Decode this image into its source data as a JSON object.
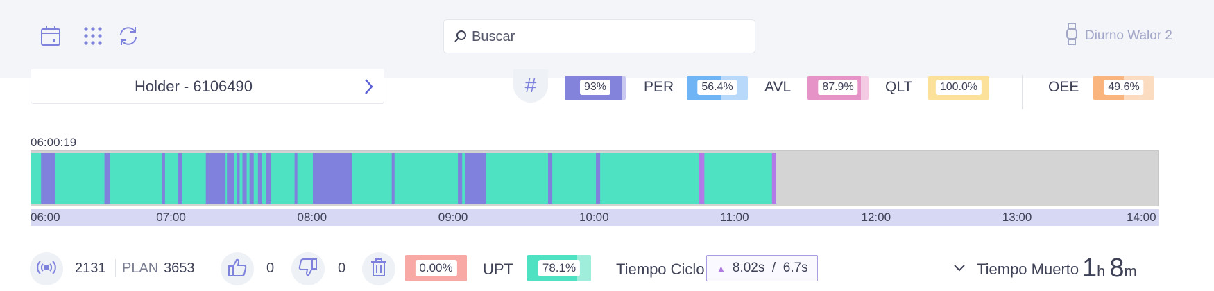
{
  "header": {
    "search_placeholder": "Buscar",
    "user_name": "Diurno Walor 2",
    "icons": [
      "calendar-icon",
      "apps-grid-icon",
      "refresh-icon",
      "watch-icon",
      "search-icon"
    ]
  },
  "holder": {
    "label": "Holder - 6106490"
  },
  "kpis": [
    {
      "name": "#",
      "label": "",
      "value": "93%",
      "fraction": 0.93,
      "color": "#8383dc",
      "light": "#c8c8f0"
    },
    {
      "name": "PER",
      "label": "PER",
      "value": "56.4%",
      "fraction": 0.564,
      "color": "#6fb4f5",
      "light": "#b8d9fa"
    },
    {
      "name": "AVL",
      "label": "AVL",
      "value": "87.9%",
      "fraction": 0.879,
      "color": "#e693c8",
      "light": "#f4cbe3"
    },
    {
      "name": "QLT",
      "label": "QLT",
      "value": "100.0%",
      "fraction": 1.0,
      "color": "#fbe19a",
      "light": "#fdf0c8"
    },
    {
      "name": "OEE",
      "label": "OEE",
      "value": "49.6%",
      "fraction": 0.496,
      "color": "#f9b57d",
      "light": "#fcdcc0"
    }
  ],
  "timeline": {
    "start_label": "06:00:19",
    "ticks": [
      "06:00",
      "07:00",
      "08:00",
      "09:00",
      "10:00",
      "11:00",
      "12:00",
      "13:00",
      "14:00"
    ],
    "range_hours": [
      6,
      14
    ],
    "colors": {
      "running": "#4ee2c2",
      "stopped": "#8080dd",
      "alarm": "#b27ae6",
      "empty": "#d4d4d4"
    },
    "run_segment": {
      "start": 6.0,
      "end": 11.29
    },
    "stop_events": [
      {
        "start": 6.07,
        "end": 6.17,
        "kind": "stopped"
      },
      {
        "start": 6.52,
        "end": 6.56,
        "kind": "stopped"
      },
      {
        "start": 6.93,
        "end": 6.95,
        "kind": "stopped"
      },
      {
        "start": 7.04,
        "end": 7.07,
        "kind": "stopped"
      },
      {
        "start": 7.24,
        "end": 7.38,
        "kind": "stopped"
      },
      {
        "start": 7.39,
        "end": 7.44,
        "kind": "stopped"
      },
      {
        "start": 7.46,
        "end": 7.48,
        "kind": "stopped"
      },
      {
        "start": 7.5,
        "end": 7.53,
        "kind": "stopped"
      },
      {
        "start": 7.55,
        "end": 7.58,
        "kind": "stopped"
      },
      {
        "start": 7.61,
        "end": 7.64,
        "kind": "stopped"
      },
      {
        "start": 7.67,
        "end": 7.7,
        "kind": "stopped"
      },
      {
        "start": 7.87,
        "end": 7.89,
        "kind": "stopped"
      },
      {
        "start": 8.0,
        "end": 8.28,
        "kind": "stopped"
      },
      {
        "start": 8.56,
        "end": 8.58,
        "kind": "stopped"
      },
      {
        "start": 9.03,
        "end": 9.06,
        "kind": "stopped"
      },
      {
        "start": 9.08,
        "end": 9.23,
        "kind": "stopped"
      },
      {
        "start": 9.67,
        "end": 9.7,
        "kind": "stopped"
      },
      {
        "start": 10.01,
        "end": 10.04,
        "kind": "stopped"
      },
      {
        "start": 10.74,
        "end": 10.78,
        "kind": "alarm"
      },
      {
        "start": 11.26,
        "end": 11.29,
        "kind": "alarm"
      }
    ]
  },
  "bottom": {
    "count": "2131",
    "plan_label": "PLAN",
    "plan_value": "3653",
    "likes": "0",
    "dislikes": "0",
    "scrap_value": "0.00%",
    "scrap_fraction": 0.0,
    "upt_label": "UPT",
    "upt_value": "78.1%",
    "upt_fraction": 0.781,
    "cycle_label": "Tiempo Ciclo",
    "cycle_value": "8.02s  /  6.7s",
    "dead_label": "Tiempo Muerto",
    "dead_hours": "1",
    "dead_h_unit": "h",
    "dead_minutes": "8",
    "dead_m_unit": "m"
  }
}
